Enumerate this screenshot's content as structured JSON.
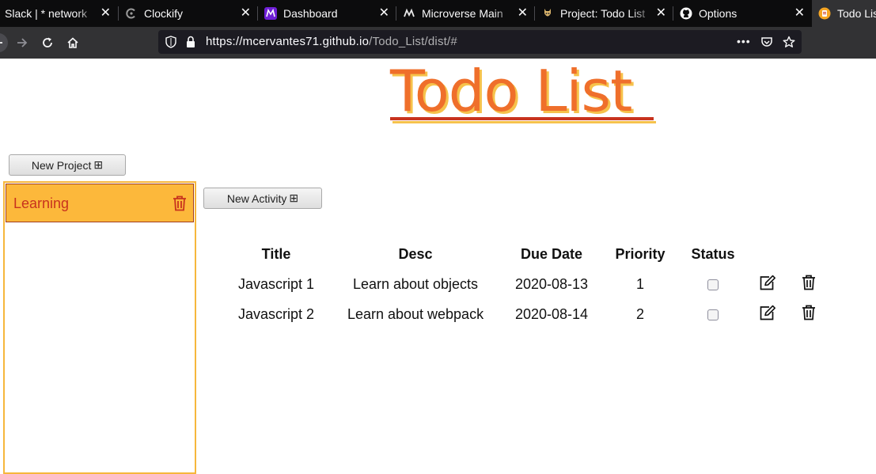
{
  "browser": {
    "tabs": [
      {
        "label": "Slack | * network",
        "icon": "slack-icon"
      },
      {
        "label": "Clockify",
        "icon": "clockify-icon"
      },
      {
        "label": "Dashboard",
        "icon": "microverse-icon"
      },
      {
        "label": "Microverse Main",
        "icon": "microverse-icon"
      },
      {
        "label": "Project: Todo List",
        "icon": "project-icon"
      },
      {
        "label": "Options",
        "icon": "github-icon"
      },
      {
        "label": "Todo Lis",
        "icon": "todo-icon"
      }
    ],
    "url": {
      "host": "https://mcervantes71.github.io",
      "path": "/Todo_List/dist/#"
    },
    "more_glyph": "•••"
  },
  "page": {
    "title": "Todo List",
    "new_project_label": "New Project",
    "new_activity_label": "New Activity",
    "plus_glyph": "⊞"
  },
  "projects": [
    {
      "name": "Learning"
    }
  ],
  "table": {
    "headers": [
      "Title",
      "Desc",
      "Due Date",
      "Priority",
      "Status"
    ],
    "rows": [
      {
        "title": "Javascript 1",
        "desc": "Learn about objects",
        "due": "2020-08-13",
        "priority": "1",
        "status": false
      },
      {
        "title": "Javascript 2",
        "desc": "Learn about webpack",
        "due": "2020-08-14",
        "priority": "2",
        "status": false
      }
    ]
  },
  "colors": {
    "title_orange": "#ef6f2b",
    "title_shadow": "#f6c24b",
    "accent_red": "#c8331e",
    "project_bg": "#fcb83b"
  }
}
